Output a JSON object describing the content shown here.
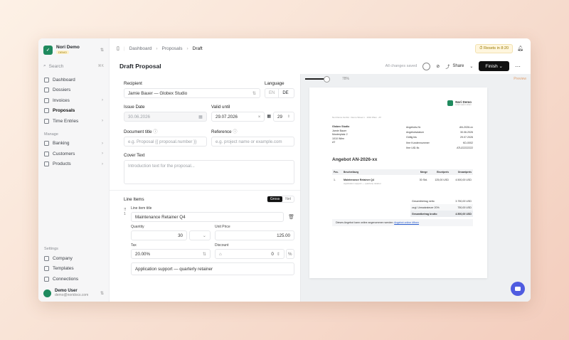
{
  "org": {
    "name": "Nori Demo",
    "badge": "DEMO"
  },
  "search": {
    "placeholder": "Search",
    "shortcut": "⌘K"
  },
  "nav": [
    {
      "label": "Dashboard",
      "active": false,
      "chevron": ""
    },
    {
      "label": "Dossiers",
      "active": false,
      "chevron": ""
    },
    {
      "label": "Invoices",
      "active": false,
      "chevron": "›"
    },
    {
      "label": "Proposals",
      "active": true,
      "chevron": ""
    },
    {
      "label": "Time Entries",
      "active": false,
      "chevron": "›"
    }
  ],
  "manage": {
    "label": "Manage",
    "items": [
      {
        "label": "Banking",
        "chevron": "›"
      },
      {
        "label": "Customers",
        "chevron": "›"
      },
      {
        "label": "Products",
        "chevron": "›"
      }
    ]
  },
  "settings": {
    "label": "Settings",
    "items": [
      {
        "label": "Company"
      },
      {
        "label": "Templates"
      },
      {
        "label": "Connections"
      }
    ]
  },
  "user": {
    "name": "Demo User",
    "email": "demo@noridocs.com"
  },
  "breadcrumb": {
    "a": "Dashboard",
    "b": "Proposals",
    "c": "Draft"
  },
  "resets": "Resets in 8:20",
  "header": {
    "title": "Draft Proposal",
    "saved": "All changes saved",
    "share": "Share",
    "finish": "Finish"
  },
  "form": {
    "recipient_label": "Recipient",
    "recipient_value": "Jamie Bauer — Globex Studio",
    "language_label": "Language",
    "lang_en": "EN",
    "lang_de": "DE",
    "issue_label": "Issue Date",
    "issue_value": "30.06.2026",
    "valid_label": "Valid until",
    "valid_value": "29.07.2026",
    "valid_days": "29",
    "doctitle_label": "Document title",
    "doctitle_placeholder": "e.g. Proposal {{ proposal.number }}",
    "reference_label": "Reference",
    "reference_placeholder": "e.g. project name or example.com",
    "cover_label": "Cover Text",
    "cover_placeholder": "Introduction text for the proposal...",
    "lineitems_label": "Line Items",
    "gross": "Gross",
    "net": "Net",
    "item_title_label": "Line item title",
    "item_index": "1",
    "item_title": "Maintenance Retainer Q4",
    "quantity_label": "Quantity",
    "quantity": "30",
    "unitprice_label": "Unit Price",
    "unitprice": "125.00",
    "tax_label": "Tax",
    "tax": "20.00%",
    "discount_label": "Discount",
    "discount": "0",
    "description": "Application support — quarterly retainer"
  },
  "preview": {
    "zoom": 0.78,
    "zoom_label": "78%",
    "label": "Preview",
    "logo_text": "Nori Demo",
    "logo_sub": "Lorem ipsum street",
    "sender_line": "Nori Demo GmbH · Demo Street 1 · 1010 Wien · AT",
    "address": [
      "Globex Studio",
      "Jamie Bauer",
      "Musterplatz 2",
      "1010 Wien",
      "AT"
    ],
    "meta": [
      {
        "k": "Angebots-Nr.",
        "v": "AN-2026-xx"
      },
      {
        "k": "Angebotsdatum",
        "v": "30.06.2026"
      },
      {
        "k": "Gültig bis",
        "v": "29.07.2026"
      },
      {
        "k": "Ihre Kundennummer",
        "v": "KD-0002"
      },
      {
        "k": "Ihre UID-Nr.",
        "v": "ATU22222222"
      }
    ],
    "doc_title": "Angebot AN-2026-xx",
    "table_headers": [
      "Pos.",
      "Beschreibung",
      "Menge",
      "Einzelpreis",
      "Gesamtpreis"
    ],
    "row": {
      "pos": "1.",
      "desc": "Maintenance Retainer Q4",
      "sub": "Application support — quarterly retainer",
      "qty": "30 Std.",
      "unit": "125,00 USD",
      "total": "4.500,00 USD"
    },
    "totals": [
      {
        "k": "Gesamtbetrag netto",
        "v": "3.750,00 USD",
        "cls": ""
      },
      {
        "k": "zzgl. Umsatzsteuer 20%",
        "v": "750,00 USD",
        "cls": "bg"
      },
      {
        "k": "Gesamtbetrag brutto",
        "v": "4.500,00 USD",
        "cls": "grand"
      }
    ],
    "accept_text": "Dieses Angebot kann online angenommen werden:",
    "accept_link": "Angebot online öffnen"
  },
  "colors": {
    "accent": "#1f8a5e",
    "chat": "#4f5ce0"
  }
}
